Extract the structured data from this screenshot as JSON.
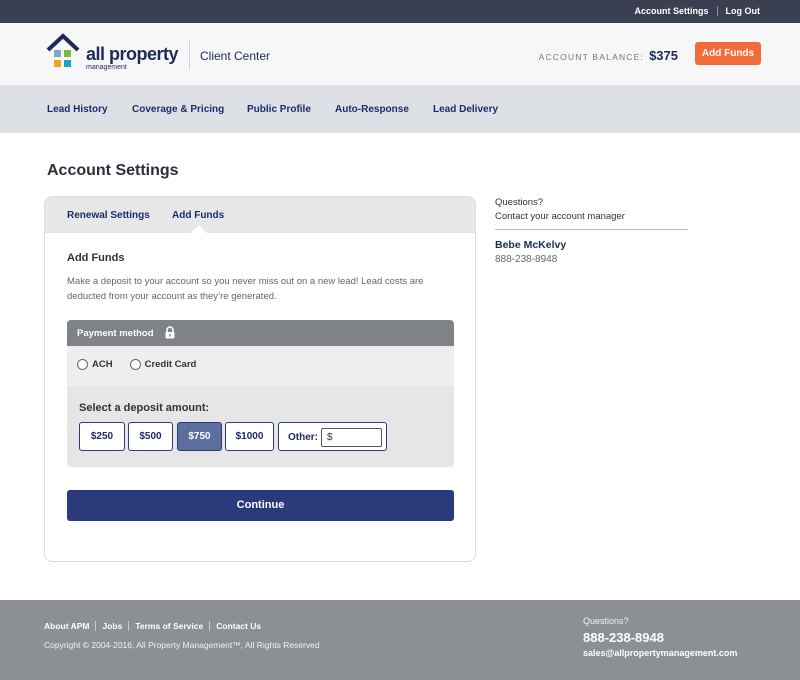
{
  "topbar": {
    "account_settings": "Account Settings",
    "log_out": "Log Out"
  },
  "header": {
    "logo_text": "all property",
    "logo_sub": "management",
    "client_center": "Client Center",
    "balance_label": "ACCOUNT BALANCE:",
    "balance_value": "$375",
    "add_funds_button": "Add Funds"
  },
  "nav": {
    "items": [
      {
        "label": "Lead History"
      },
      {
        "label": "Coverage & Pricing"
      },
      {
        "label": "Public Profile"
      },
      {
        "label": "Auto-Response"
      },
      {
        "label": "Lead Delivery"
      }
    ]
  },
  "page_title": "Account Settings",
  "card": {
    "tabs": [
      {
        "label": "Renewal Settings"
      },
      {
        "label": "Add Funds",
        "active": true
      }
    ],
    "heading": "Add Funds",
    "description": "Make a deposit to your account so you never miss out on a new lead! Lead costs are deducted from your account as they’re generated.",
    "payment": {
      "header": "Payment method",
      "options": [
        {
          "label": "ACH",
          "checked": false
        },
        {
          "label": "Credit Card",
          "checked": false
        }
      ],
      "deposit_label": "Select a deposit amount:",
      "amounts": [
        {
          "label": "$250",
          "selected": false
        },
        {
          "label": "$500",
          "selected": false
        },
        {
          "label": "$750",
          "selected": true
        },
        {
          "label": "$1000",
          "selected": false
        }
      ],
      "other_label": "Other:",
      "other_value": "$"
    },
    "continue_button": "Continue"
  },
  "sidebar": {
    "question": "Questions?",
    "contact_line": "Contact your account manager",
    "manager_name": "Bebe McKelvy",
    "manager_phone": "888-238-8948"
  },
  "footer": {
    "links": [
      {
        "label": "About APM"
      },
      {
        "label": "Jobs"
      },
      {
        "label": "Terms of Service"
      },
      {
        "label": "Contact Us"
      }
    ],
    "copyright": "Copyright © 2004-2016, All Property Management™, All Rights Reserved",
    "question": "Questions?",
    "phone": "888-238-8948",
    "email": "sales@allpropertymanagement.com"
  },
  "colors": {
    "accent_orange": "#f26b3a",
    "navy": "#2b3a7a",
    "selected_amount": "#5c6f9d",
    "topbar": "#3a4052",
    "footer": "#8c8f94"
  },
  "icons": {
    "lock": "lock-icon",
    "logo": "house-logo-icon"
  }
}
